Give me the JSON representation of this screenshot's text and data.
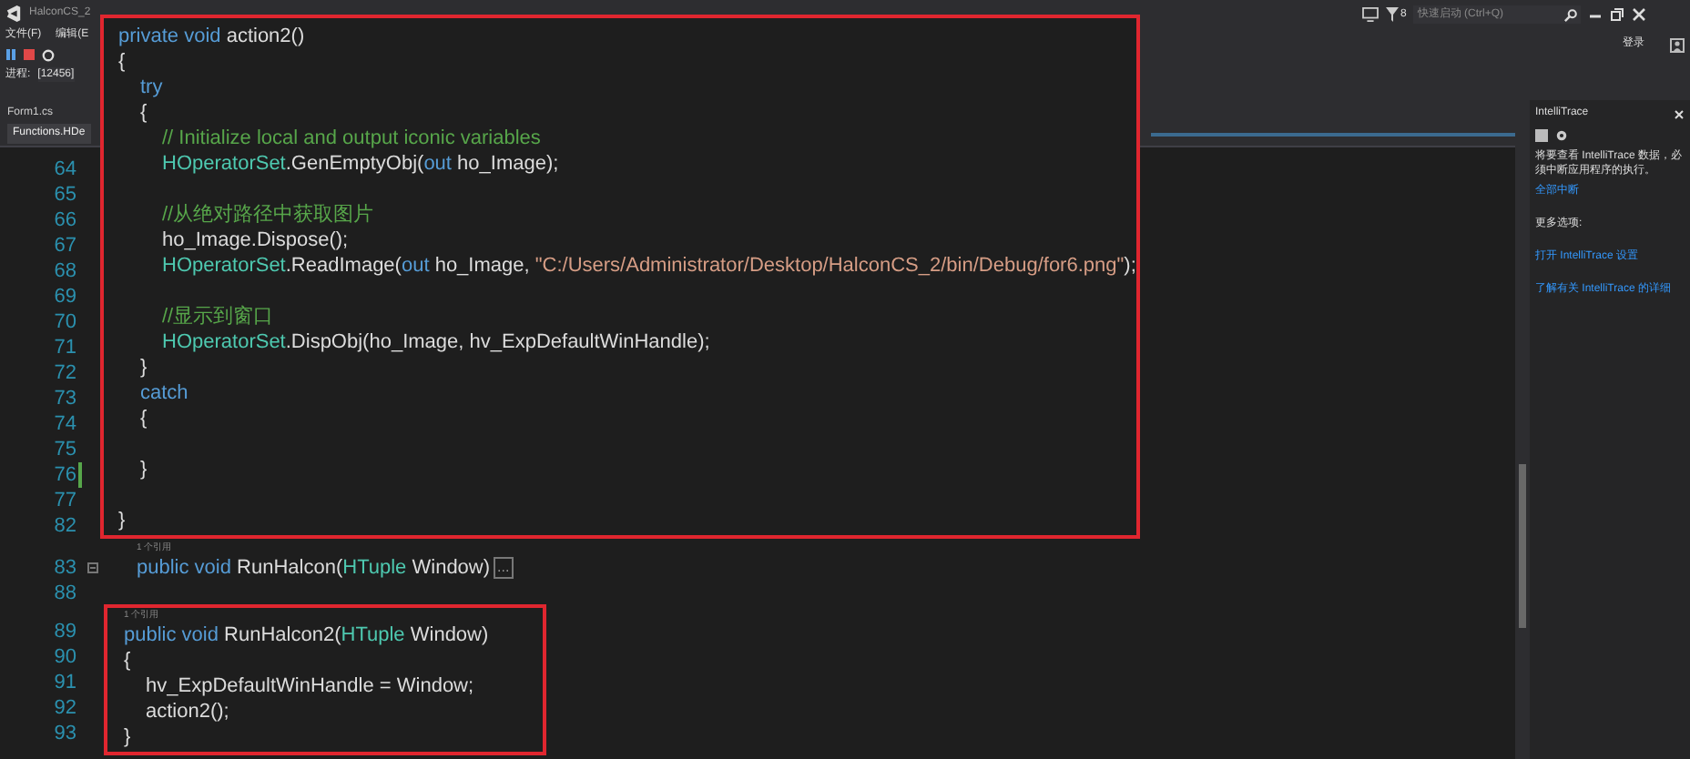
{
  "title_bar": {
    "title": "HalconCS_2",
    "menu": [
      "文件(F)",
      "编辑(E"
    ],
    "process_label": "进程:",
    "process_id": "[12456]",
    "notifications": "8",
    "search": {
      "placeholder": "快速启动 (Ctrl+Q)"
    },
    "sign_in": "登录"
  },
  "tabs": [
    {
      "label": "Form1.cs",
      "selected": false
    },
    {
      "label": "Functions.HDe",
      "selected": true
    }
  ],
  "editor": {
    "lines": [
      {
        "number": "64",
        "changed": false,
        "fold": false
      },
      {
        "number": "65",
        "changed": false,
        "fold": false
      },
      {
        "number": "66",
        "changed": false,
        "fold": false
      },
      {
        "number": "67",
        "changed": false,
        "fold": false
      },
      {
        "number": "68",
        "changed": false,
        "fold": false
      },
      {
        "number": "69",
        "changed": false,
        "fold": false
      },
      {
        "number": "70",
        "changed": false,
        "fold": false
      },
      {
        "number": "71",
        "changed": false,
        "fold": false
      },
      {
        "number": "72",
        "changed": false,
        "fold": false
      },
      {
        "number": "73",
        "changed": false,
        "fold": false
      },
      {
        "number": "74",
        "changed": false,
        "fold": false
      },
      {
        "number": "75",
        "changed": false,
        "fold": false
      },
      {
        "number": "76",
        "changed": true,
        "fold": false
      },
      {
        "number": "77",
        "changed": false,
        "fold": false
      },
      {
        "number": "82",
        "changed": false,
        "fold": false
      },
      {
        "number": "83",
        "changed": false,
        "fold": true,
        "lens": "1 个引用",
        "tokens": [
          {
            "kind": "keyword",
            "text": "public void"
          },
          {
            "kind": "plain",
            "text": " RunHalcon("
          },
          {
            "kind": "type",
            "text": "HTuple"
          },
          {
            "kind": "plain",
            "text": " Window)"
          },
          {
            "kind": "collapsed",
            "text": "..."
          }
        ]
      },
      {
        "number": "88",
        "changed": false,
        "fold": false
      }
    ]
  },
  "highlight_1": {
    "lines": [
      {
        "kind": "code",
        "tokens": [
          {
            "kind": "keyword",
            "text": "private void"
          },
          {
            "kind": "plain",
            "text": " action2()"
          }
        ]
      },
      {
        "kind": "code",
        "tokens": [
          {
            "kind": "plain",
            "text": "{"
          }
        ]
      },
      {
        "kind": "block",
        "children": [
          {
            "kind": "code",
            "tokens": [
              {
                "kind": "keyword",
                "text": "try"
              }
            ]
          },
          {
            "kind": "code",
            "tokens": [
              {
                "kind": "plain",
                "text": "{"
              }
            ]
          },
          {
            "kind": "block",
            "children": [
              {
                "kind": "code",
                "tokens": [
                  {
                    "kind": "comment",
                    "text": "// Initialize local and output iconic variables"
                  }
                ]
              },
              {
                "kind": "code",
                "tokens": [
                  {
                    "kind": "type",
                    "text": "HOperatorSet"
                  },
                  {
                    "kind": "plain",
                    "text": ".GenEmptyObj("
                  },
                  {
                    "kind": "keyword",
                    "text": "out"
                  },
                  {
                    "kind": "plain",
                    "text": " ho_Image);"
                  }
                ]
              },
              {
                "kind": "blank"
              },
              {
                "kind": "code",
                "tokens": [
                  {
                    "kind": "comment",
                    "text": "//从绝对路径中获取图片"
                  }
                ]
              },
              {
                "kind": "code",
                "tokens": [
                  {
                    "kind": "plain",
                    "text": "ho_Image.Dispose();"
                  }
                ]
              },
              {
                "kind": "code",
                "tokens": [
                  {
                    "kind": "type",
                    "text": "HOperatorSet"
                  },
                  {
                    "kind": "plain",
                    "text": ".ReadImage("
                  },
                  {
                    "kind": "keyword",
                    "text": "out"
                  },
                  {
                    "kind": "plain",
                    "text": " ho_Image, "
                  },
                  {
                    "kind": "string",
                    "text": "\"C:/Users/Administrator/Desktop/HalconCS_2/bin/Debug/for6.png\""
                  },
                  {
                    "kind": "plain",
                    "text": ");"
                  }
                ]
              },
              {
                "kind": "blank"
              },
              {
                "kind": "code",
                "tokens": [
                  {
                    "kind": "comment",
                    "text": "//显示到窗口"
                  }
                ]
              },
              {
                "kind": "code",
                "tokens": [
                  {
                    "kind": "type",
                    "text": "HOperatorSet"
                  },
                  {
                    "kind": "plain",
                    "text": ".DispObj(ho_Image, hv_ExpDefaultWinHandle);"
                  }
                ]
              }
            ]
          },
          {
            "kind": "code",
            "tokens": [
              {
                "kind": "plain",
                "text": "}"
              }
            ]
          },
          {
            "kind": "code",
            "tokens": [
              {
                "kind": "keyword",
                "text": "catch"
              }
            ]
          },
          {
            "kind": "code",
            "tokens": [
              {
                "kind": "plain",
                "text": "{"
              }
            ]
          },
          {
            "kind": "blank"
          },
          {
            "kind": "code",
            "tokens": [
              {
                "kind": "plain",
                "text": "}"
              }
            ]
          },
          {
            "kind": "blank"
          }
        ]
      },
      {
        "kind": "code",
        "tokens": [
          {
            "kind": "plain",
            "text": "}"
          }
        ]
      }
    ]
  },
  "highlight_2": {
    "lens": "1 个引用",
    "numbers": [
      "89",
      "90",
      "91",
      "92",
      "93"
    ],
    "lines": [
      {
        "kind": "code",
        "tokens": [
          {
            "kind": "keyword",
            "text": "public void"
          },
          {
            "kind": "plain",
            "text": " RunHalcon2("
          },
          {
            "kind": "type",
            "text": "HTuple"
          },
          {
            "kind": "plain",
            "text": " Window)"
          }
        ]
      },
      {
        "kind": "code",
        "tokens": [
          {
            "kind": "plain",
            "text": "{"
          }
        ]
      },
      {
        "kind": "block",
        "children": [
          {
            "kind": "code",
            "tokens": [
              {
                "kind": "plain",
                "text": "hv_ExpDefaultWinHandle = Window;"
              }
            ]
          },
          {
            "kind": "code",
            "tokens": [
              {
                "kind": "plain",
                "text": "action2();"
              }
            ]
          }
        ]
      },
      {
        "kind": "code",
        "tokens": [
          {
            "kind": "plain",
            "text": "}"
          }
        ]
      }
    ]
  },
  "intellitrace": {
    "title": "IntelliTrace",
    "message": "将要查看 IntelliTrace 数据，必须中断应用程序的执行。",
    "break_all": "全部中断",
    "more_options": "更多选项:",
    "links": [
      "打开 IntelliTrace 设置",
      "了解有关 IntelliTrace 的详细"
    ]
  }
}
